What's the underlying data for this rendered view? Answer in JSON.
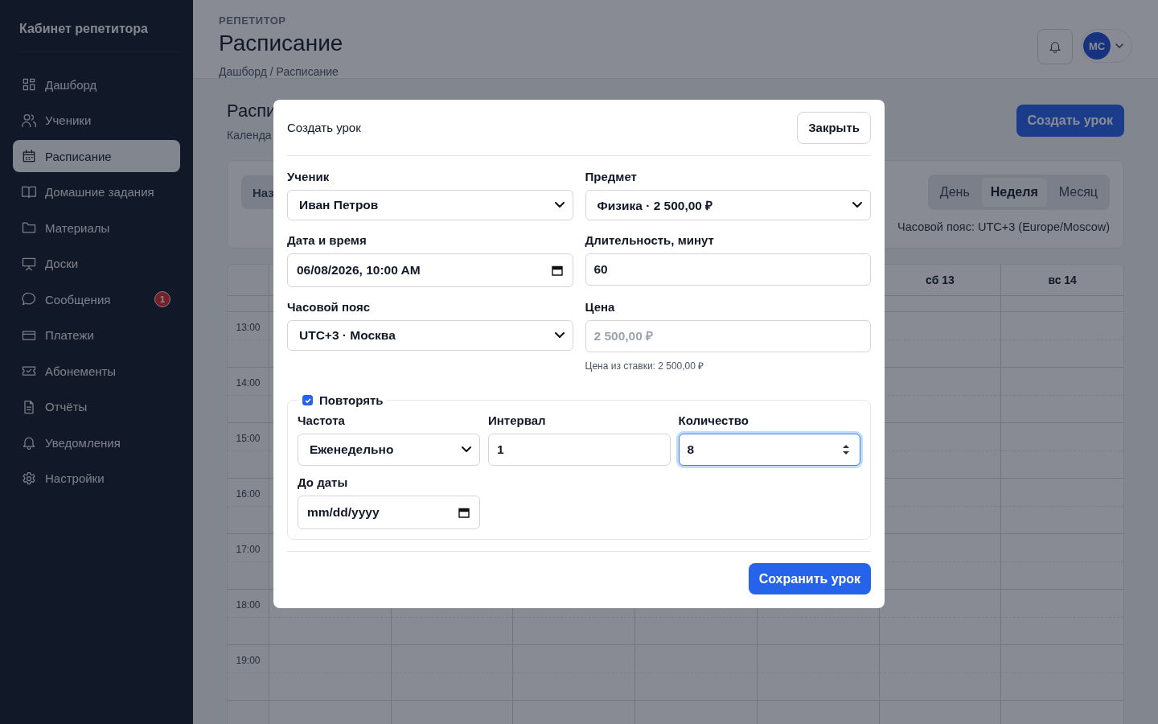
{
  "sidebar": {
    "title": "Кабинет репетитора",
    "items": [
      {
        "label": "Дашборд",
        "selected": false
      },
      {
        "label": "Ученики",
        "selected": false
      },
      {
        "label": "Расписание",
        "selected": true
      },
      {
        "label": "Домашние задания",
        "selected": false
      },
      {
        "label": "Материалы",
        "selected": false
      },
      {
        "label": "Доски",
        "selected": false
      },
      {
        "label": "Сообщения",
        "selected": false,
        "badge": "1"
      },
      {
        "label": "Платежи",
        "selected": false
      },
      {
        "label": "Абонементы",
        "selected": false
      },
      {
        "label": "Отчёты",
        "selected": false
      },
      {
        "label": "Уведомления",
        "selected": false
      },
      {
        "label": "Настройки",
        "selected": false
      }
    ]
  },
  "header": {
    "eyebrow": "РЕПЕТИТОР",
    "title": "Расписание",
    "breadcrumb": "Дашборд / Расписание",
    "avatar": "МС"
  },
  "page": {
    "title": "Распи",
    "subtitle": "Календа",
    "create_button": "Создать урок"
  },
  "toolbar": {
    "nav_button": "Наз",
    "views": [
      {
        "label": "День",
        "selected": false
      },
      {
        "label": "Неделя",
        "selected": true
      },
      {
        "label": "Месяц",
        "selected": false
      }
    ],
    "timezone": "Часовой пояс: UTC+3 (Europe/Moscow)"
  },
  "calendar": {
    "visible_days": [
      "сб 13",
      "вс 14"
    ],
    "times": [
      "13:00",
      "14:00",
      "15:00",
      "16:00",
      "17:00",
      "18:00",
      "19:00"
    ]
  },
  "modal": {
    "title": "Создать урок",
    "close_button": "Закрыть",
    "fields": [
      {
        "kind": "select",
        "label": "Ученик",
        "value": "Иван Петров"
      },
      {
        "kind": "select",
        "label": "Предмет",
        "value": "Физика · 2 500,00 ₽"
      },
      {
        "kind": "date",
        "label": "Дата и время",
        "value": "06/08/2026, 10:00 AM"
      },
      {
        "kind": "text",
        "label": "Длительность, минут",
        "value": "60"
      },
      {
        "kind": "select",
        "label": "Часовой пояс",
        "value": "UTC+3 · Москва"
      },
      {
        "kind": "text",
        "label": "Цена",
        "placeholder": "2 500,00 ₽",
        "hint": "Цена из ставки: 2 500,00 ₽"
      }
    ],
    "repeat": {
      "label": "Повторять",
      "checked": true,
      "fields": [
        {
          "kind": "select",
          "label": "Частота",
          "value": "Еженедельно"
        },
        {
          "kind": "text",
          "label": "Интервал",
          "value": "1"
        },
        {
          "kind": "number",
          "label": "Количество",
          "value": "8",
          "focused": true
        },
        {
          "kind": "date",
          "label": "До даты",
          "value": "mm/dd/yyyy"
        }
      ]
    },
    "save_button": "Сохранить урок"
  }
}
